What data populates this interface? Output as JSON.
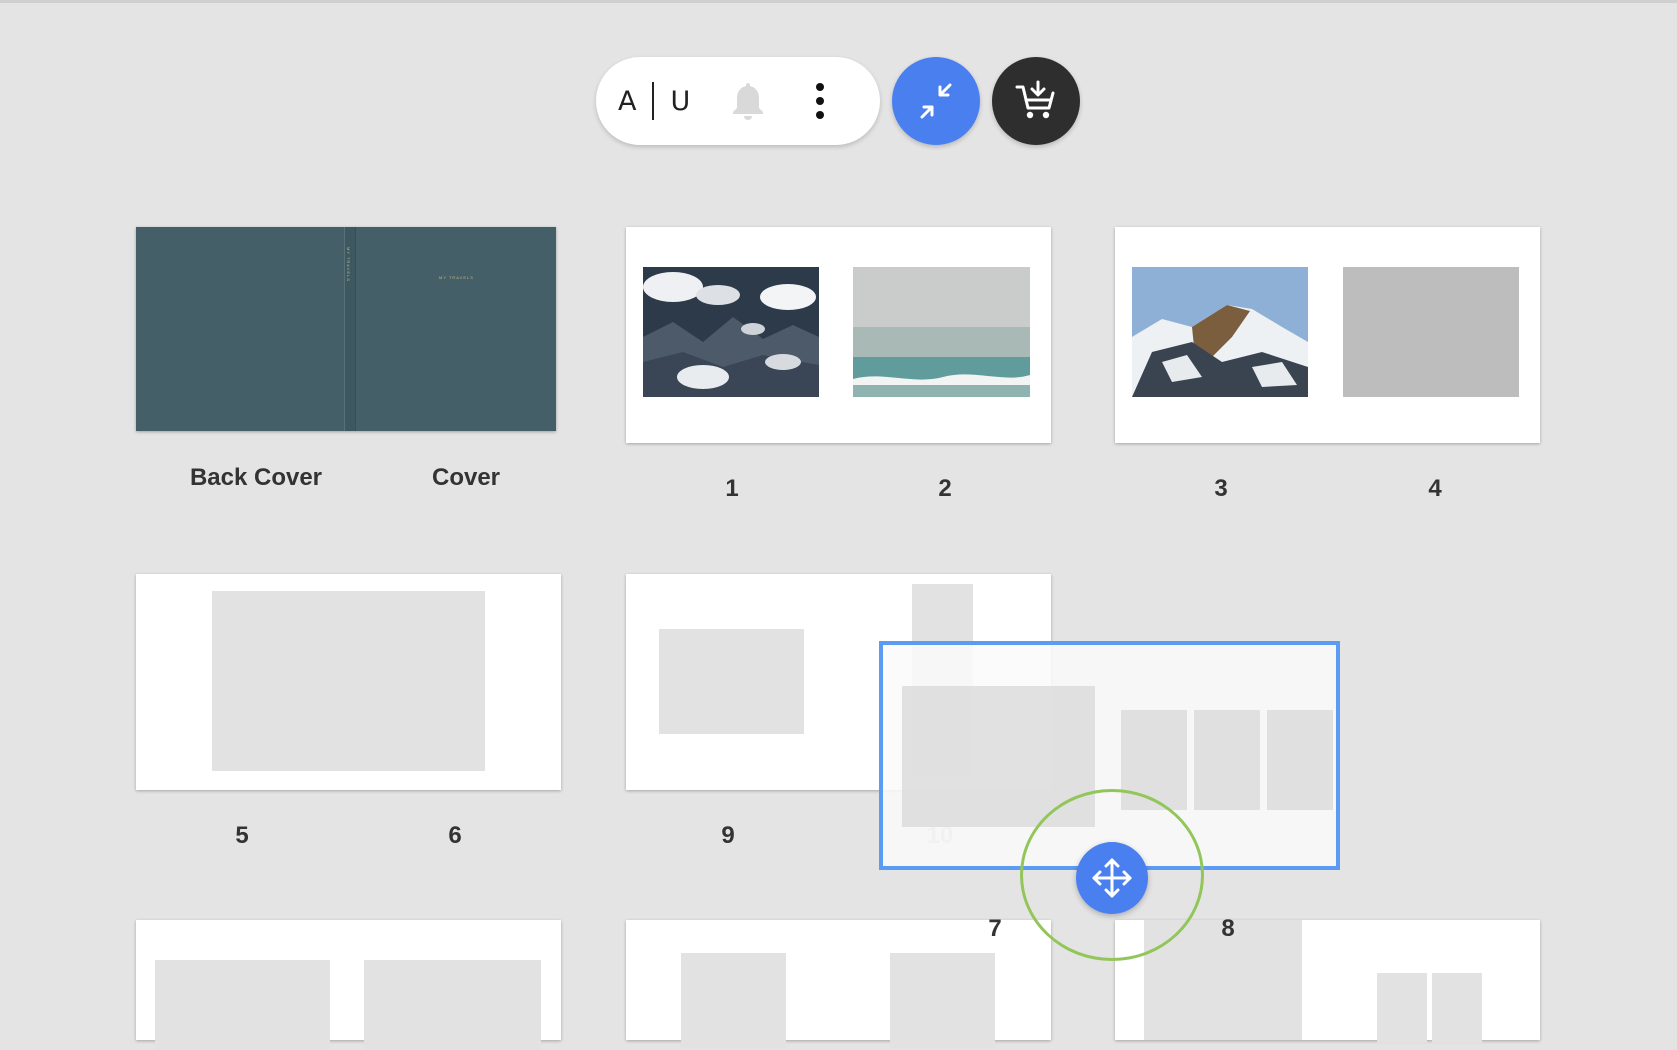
{
  "toolbar": {
    "avatar_left": "A",
    "avatar_right": "U",
    "bell_icon": "bell-icon",
    "menu_icon": "more-vert-icon",
    "collapse_icon": "collapse-arrows-icon",
    "cart_icon": "cart-download-icon"
  },
  "spreads": {
    "cover": {
      "left_label": "Back Cover",
      "right_label": "Cover",
      "spine_text": "MY TRAVELS",
      "title": "MY TRAVELS"
    },
    "s1": {
      "left_label": "1",
      "right_label": "2"
    },
    "s2": {
      "left_label": "3",
      "right_label": "4"
    },
    "s3": {
      "left_label": "5",
      "right_label": "6"
    },
    "s4": {
      "left_label": "9",
      "right_label": "10"
    }
  },
  "drag": {
    "left_label": "7",
    "right_label": "8",
    "move_icon": "move-arrows-icon"
  },
  "colors": {
    "accent": "#4a7ff0",
    "cover": "#445f67",
    "drag_border": "#5b9bf3",
    "drop_ring": "#93c65a"
  }
}
